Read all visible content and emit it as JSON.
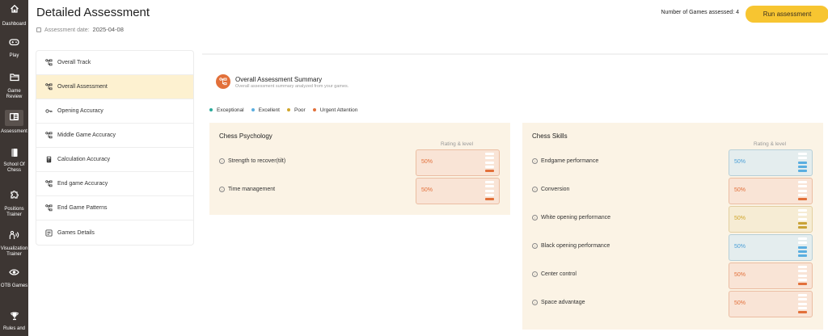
{
  "sidebar": {
    "items": [
      {
        "label": "Dashboard",
        "icon": "home-icon"
      },
      {
        "label": "Play",
        "icon": "gamepad-icon"
      },
      {
        "label": "Game Review",
        "icon": "folder-icon"
      },
      {
        "label": "Assessment",
        "icon": "assessment-icon",
        "active": true
      },
      {
        "label": "School Of Chess",
        "icon": "book-icon"
      },
      {
        "label": "Positions Trainer",
        "icon": "puzzle-icon"
      },
      {
        "label": "Visualization Trainer",
        "icon": "visualization-icon"
      },
      {
        "label": "OTB Games",
        "icon": "eye-icon"
      },
      {
        "label": "Rules and",
        "icon": "trophy-icon"
      }
    ]
  },
  "header": {
    "title": "Detailed Assessment",
    "date_label": "Assessment date:",
    "date_value": "2025-04-08",
    "games_label": "Number of Games assessed:",
    "games_count": "4",
    "run_button": "Run assessment"
  },
  "nav": {
    "items": [
      {
        "label": "Overall Track",
        "icon": "flow-icon"
      },
      {
        "label": "Overall Assessment",
        "icon": "flow-icon",
        "active": true
      },
      {
        "label": "Opening Accuracy",
        "icon": "key-icon"
      },
      {
        "label": "Middle Game Accuracy",
        "icon": "flow-icon"
      },
      {
        "label": "Calculation Accuracy",
        "icon": "calculator-icon"
      },
      {
        "label": "End game Accuracy",
        "icon": "flow-icon"
      },
      {
        "label": "End Game Patterns",
        "icon": "flow-icon"
      },
      {
        "label": "Games Details",
        "icon": "document-icon"
      }
    ]
  },
  "summary": {
    "title": "Overall Assessment Summary",
    "subtitle": "Overall assessment summary analyzed from your games."
  },
  "legend": [
    {
      "label": "Exceptional",
      "color": "#2bab9b"
    },
    {
      "label": "Excellent",
      "color": "#5aaee0"
    },
    {
      "label": "Poor",
      "color": "#d0a62c"
    },
    {
      "label": "Urgent Attention",
      "color": "#e2703a"
    }
  ],
  "levels": {
    "exceptional": {
      "bg": "#e3f3ef",
      "border": "#9dd3c9",
      "text": "#2bab9b",
      "bar": "#2bab9b",
      "filled": 4
    },
    "excellent": {
      "bg": "#e4edee",
      "border": "#b6cfd8",
      "text": "#4b9fd6",
      "bar": "#5aaee0",
      "filled": 3
    },
    "poor": {
      "bg": "#f6ecd4",
      "border": "#e3cfa0",
      "text": "#d0a62c",
      "bar": "#c9a236",
      "filled": 2
    },
    "urgent": {
      "bg": "#f9e4d6",
      "border": "#ebbda2",
      "text": "#e2703a",
      "bar": "#e2703a",
      "filled": 1
    }
  },
  "psychology": {
    "title": "Chess Psychology",
    "rating_label": "Rating & level",
    "rows": [
      {
        "label": "Strength to recover(tilt)",
        "value": "50%",
        "level": "urgent"
      },
      {
        "label": "Time management",
        "value": "50%",
        "level": "urgent"
      }
    ]
  },
  "skills": {
    "title": "Chess Skills",
    "rating_label": "Rating & level",
    "rows": [
      {
        "label": "Endgame performance",
        "value": "50%",
        "level": "excellent"
      },
      {
        "label": "Conversion",
        "value": "50%",
        "level": "urgent"
      },
      {
        "label": "White opening performance",
        "value": "50%",
        "level": "poor"
      },
      {
        "label": "Black opening performance",
        "value": "50%",
        "level": "excellent"
      },
      {
        "label": "Center control",
        "value": "50%",
        "level": "urgent"
      },
      {
        "label": "Space advantage",
        "value": "50%",
        "level": "urgent"
      }
    ]
  }
}
